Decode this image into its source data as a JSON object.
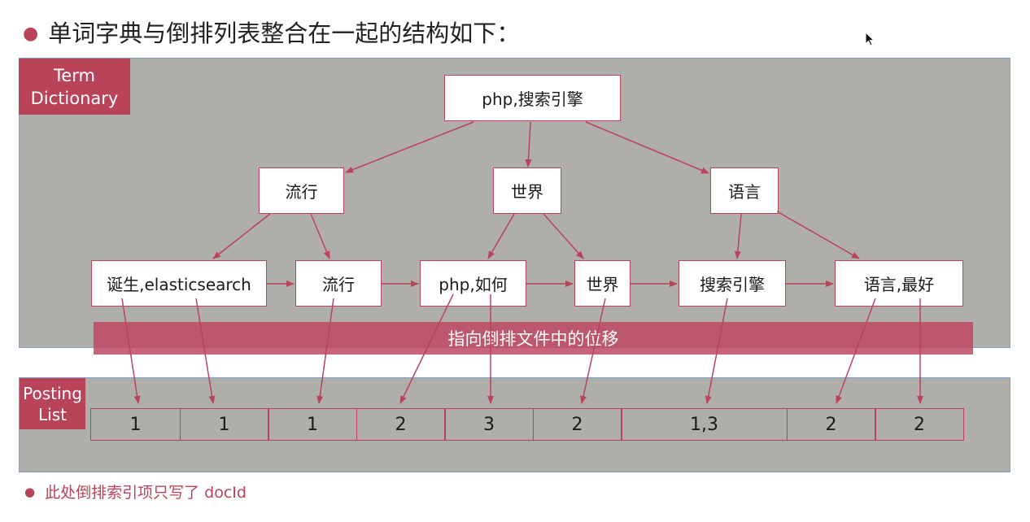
{
  "title": "单词字典与倒排列表整合在一起的结构如下：",
  "labels": {
    "term_dictionary": "Term Dictionary",
    "posting_list": "Posting List"
  },
  "tree": {
    "root": "php,搜索引擎",
    "level2": [
      "流行",
      "世界",
      "语言"
    ],
    "leaves": [
      "诞生,elasticsearch",
      "流行",
      "php,如何",
      "世界",
      "搜索引擎",
      "语言,最好"
    ]
  },
  "offset_label": "指向倒排文件中的位移",
  "posting_values": [
    "1",
    "1",
    "1",
    "2",
    "3",
    "2",
    "1,3",
    "2",
    "2"
  ],
  "footnote": "此处倒排索引项只写了 docId",
  "colors": {
    "accent": "#b9445a",
    "panel": "#b0aeab",
    "panel_border": "#7ea3cf"
  }
}
